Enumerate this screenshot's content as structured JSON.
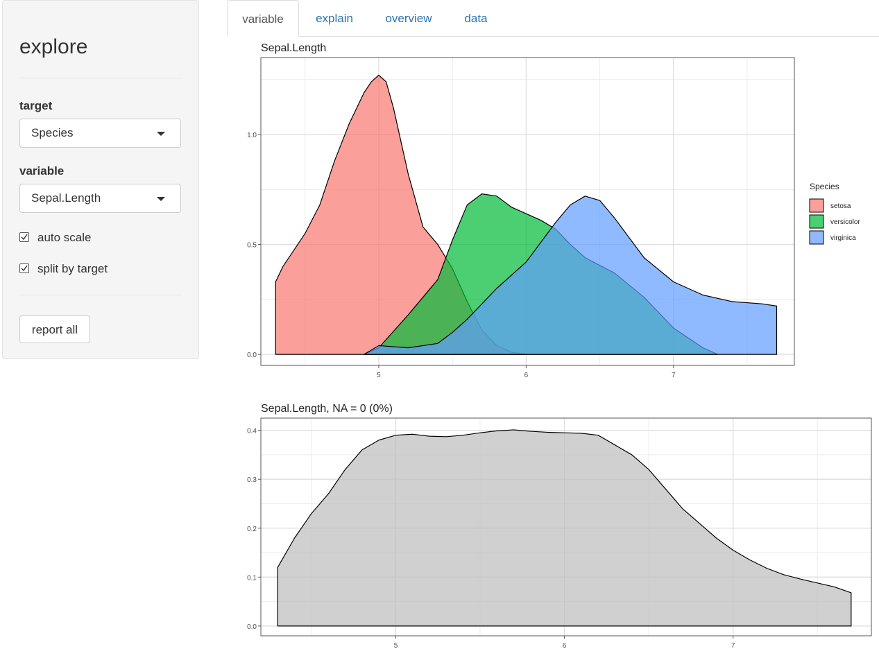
{
  "sidebar": {
    "title": "explore",
    "target_label": "target",
    "target_value": "Species",
    "variable_label": "variable",
    "variable_value": "Sepal.Length",
    "auto_scale_label": "auto scale",
    "auto_scale_checked": true,
    "split_label": "split by target",
    "split_checked": true,
    "report_button": "report all"
  },
  "tabs": [
    {
      "label": "variable",
      "active": true
    },
    {
      "label": "explain",
      "active": false
    },
    {
      "label": "overview",
      "active": false
    },
    {
      "label": "data",
      "active": false
    }
  ],
  "chart_data": [
    {
      "type": "area",
      "title": "Sepal.Length",
      "xlabel": "",
      "ylabel": "",
      "xlim": [
        4.2,
        7.82
      ],
      "ylim": [
        -0.05,
        1.35
      ],
      "xticks": [
        5,
        6,
        7
      ],
      "xtick_labels": [
        "5",
        "6",
        "7"
      ],
      "yticks": [
        0.0,
        0.5,
        1.0
      ],
      "ytick_labels": [
        "0.0",
        "0.5",
        "1.0"
      ],
      "grid": true,
      "legend_position": "right",
      "legend_title": "Species",
      "series": [
        {
          "name": "setosa",
          "color": "#F8766D",
          "x": [
            4.3,
            4.35,
            4.4,
            4.5,
            4.6,
            4.7,
            4.8,
            4.9,
            4.95,
            5.0,
            5.05,
            5.1,
            5.2,
            5.3,
            5.4,
            5.5,
            5.6,
            5.7,
            5.8,
            5.9,
            6.0
          ],
          "y": [
            0.33,
            0.4,
            0.45,
            0.55,
            0.68,
            0.88,
            1.05,
            1.19,
            1.24,
            1.27,
            1.24,
            1.12,
            0.82,
            0.58,
            0.5,
            0.39,
            0.24,
            0.11,
            0.04,
            0.01,
            0.0
          ]
        },
        {
          "name": "versicolor",
          "color": "#00BA38",
          "x": [
            4.9,
            5.0,
            5.2,
            5.4,
            5.5,
            5.6,
            5.7,
            5.8,
            5.9,
            6.0,
            6.1,
            6.2,
            6.3,
            6.4,
            6.6,
            6.8,
            7.0,
            7.2,
            7.3
          ],
          "y": [
            0.0,
            0.03,
            0.18,
            0.34,
            0.52,
            0.68,
            0.73,
            0.72,
            0.67,
            0.64,
            0.61,
            0.57,
            0.5,
            0.44,
            0.37,
            0.26,
            0.12,
            0.03,
            0.0
          ]
        },
        {
          "name": "virginica",
          "color": "#619CFF",
          "x": [
            4.9,
            5.0,
            5.2,
            5.4,
            5.5,
            5.6,
            5.8,
            6.0,
            6.2,
            6.3,
            6.4,
            6.5,
            6.6,
            6.8,
            7.0,
            7.2,
            7.4,
            7.6,
            7.7
          ],
          "y": [
            0.0,
            0.04,
            0.03,
            0.05,
            0.1,
            0.16,
            0.3,
            0.42,
            0.6,
            0.68,
            0.72,
            0.7,
            0.62,
            0.44,
            0.33,
            0.27,
            0.24,
            0.23,
            0.22
          ]
        }
      ]
    },
    {
      "type": "area",
      "title": "Sepal.Length, NA = 0 (0%)",
      "xlabel": "",
      "ylabel": "",
      "xlim": [
        4.2,
        7.82
      ],
      "ylim": [
        -0.02,
        0.425
      ],
      "xticks": [
        5,
        6,
        7
      ],
      "xtick_labels": [
        "5",
        "6",
        "7"
      ],
      "yticks": [
        0.0,
        0.1,
        0.2,
        0.3,
        0.4
      ],
      "ytick_labels": [
        "0.0",
        "0.1",
        "0.2",
        "0.3",
        "0.4"
      ],
      "grid": true,
      "series": [
        {
          "name": "",
          "color": "#BEBEBE",
          "x": [
            4.3,
            4.4,
            4.5,
            4.6,
            4.7,
            4.8,
            4.9,
            5.0,
            5.1,
            5.2,
            5.3,
            5.4,
            5.5,
            5.6,
            5.7,
            5.8,
            5.9,
            6.0,
            6.1,
            6.2,
            6.3,
            6.4,
            6.5,
            6.6,
            6.7,
            6.8,
            6.9,
            7.0,
            7.1,
            7.2,
            7.3,
            7.4,
            7.5,
            7.6,
            7.7
          ],
          "y": [
            0.12,
            0.18,
            0.23,
            0.27,
            0.32,
            0.36,
            0.38,
            0.39,
            0.392,
            0.388,
            0.387,
            0.39,
            0.395,
            0.399,
            0.401,
            0.398,
            0.396,
            0.395,
            0.394,
            0.39,
            0.37,
            0.35,
            0.32,
            0.28,
            0.24,
            0.21,
            0.18,
            0.155,
            0.135,
            0.118,
            0.105,
            0.096,
            0.088,
            0.08,
            0.068
          ]
        }
      ]
    }
  ]
}
